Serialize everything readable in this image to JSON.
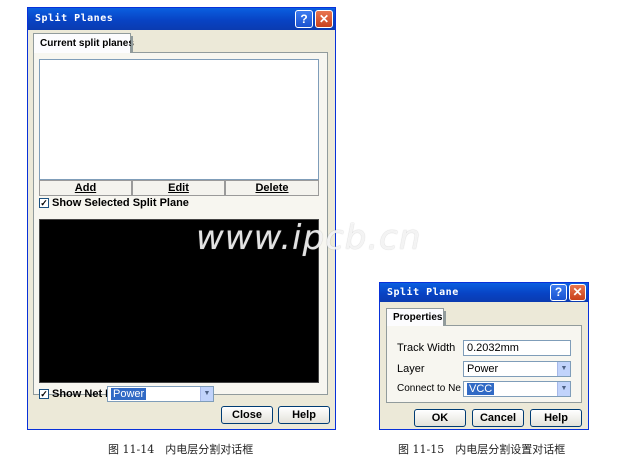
{
  "split_planes_dialog": {
    "title": "Split Planes",
    "tab_label": "Current split planes",
    "add_label": "Add",
    "edit_label": "Edit",
    "delete_label": "Delete",
    "show_selected_label": "Show Selected Split Plane",
    "show_net_label": "Show Net I",
    "net_value": "Power",
    "close_label": "Close",
    "help_label": "Help"
  },
  "split_plane_dialog": {
    "title": "Split Plane",
    "tab_label": "Properties",
    "track_width_label": "Track Width",
    "track_width_value": "0.2032mm",
    "layer_label": "Layer",
    "layer_value": "Power",
    "connect_label": "Connect to Ne",
    "connect_value": "VCC",
    "ok_label": "OK",
    "cancel_label": "Cancel",
    "help_label": "Help"
  },
  "captions": {
    "fig_14": "图 11-14　内电层分割对话框",
    "fig_15": "图 11-15　内电层分割设置对话框"
  },
  "watermark": "www.ipcb.cn",
  "icons": {
    "help": "question-mark",
    "close": "x-mark",
    "dropdown": "down-triangle",
    "check": "checkmark"
  },
  "colors": {
    "title_bar": "#0843c4",
    "dialog_face": "#ece9d8",
    "preview_background": "#000000",
    "selection": "#316ac5"
  }
}
